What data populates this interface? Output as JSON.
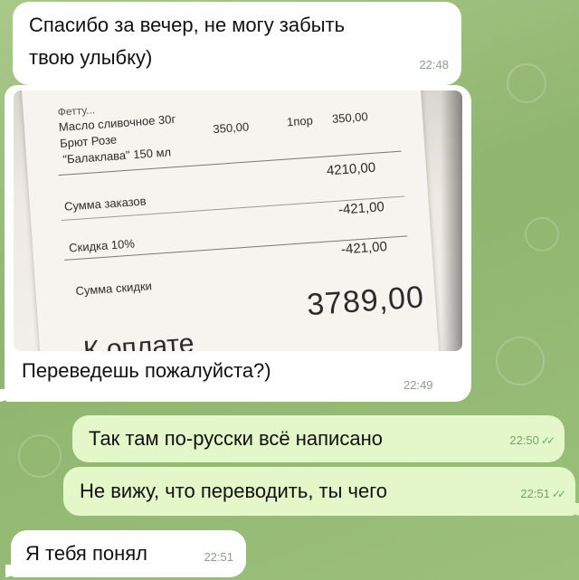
{
  "colors": {
    "incoming_bubble": "#ffffff",
    "outgoing_bubble": "#e3f7c8",
    "chat_background": "#9cc07c",
    "timestamp_incoming": "#8aa08a",
    "timestamp_outgoing": "#6fa866"
  },
  "messages": [
    {
      "direction": "incoming",
      "text_line1": "Спасибо за вечер, не могу забыть",
      "text_line2": "твою улыбку)",
      "time": "22:48"
    },
    {
      "direction": "incoming",
      "has_photo": true,
      "text": "Переведешь пожалуйста?)",
      "time": "22:49"
    },
    {
      "direction": "outgoing",
      "text": "Так там по-русски всё написано",
      "time": "22:50",
      "status_icon": "double-check-icon"
    },
    {
      "direction": "outgoing",
      "text": "Не вижу, что переводить, ты чего",
      "time": "22:51",
      "status_icon": "double-check-icon"
    },
    {
      "direction": "incoming",
      "text": "Я тебя понял",
      "time": "22:51"
    }
  ],
  "receipt": {
    "row_top_cut": "Фетту...",
    "item1": "Масло сливочное 30г",
    "item2": "Брют Розе",
    "item3": "\"Балаклава\"  150 мл",
    "item2_price": "350,00",
    "item2_qty": "1пор",
    "item2_sum": "350,00",
    "subtotal_label": "Сумма заказов",
    "subtotal_value": "4210,00",
    "discount_label": "Скидка 10%",
    "discount_value": "-421,00",
    "discount_sum_label": "Сумма скидки",
    "discount_sum_value": "-421,00",
    "pay_label": "К оплате",
    "pay_value": "3789,00"
  },
  "check_glyph": "✓✓"
}
